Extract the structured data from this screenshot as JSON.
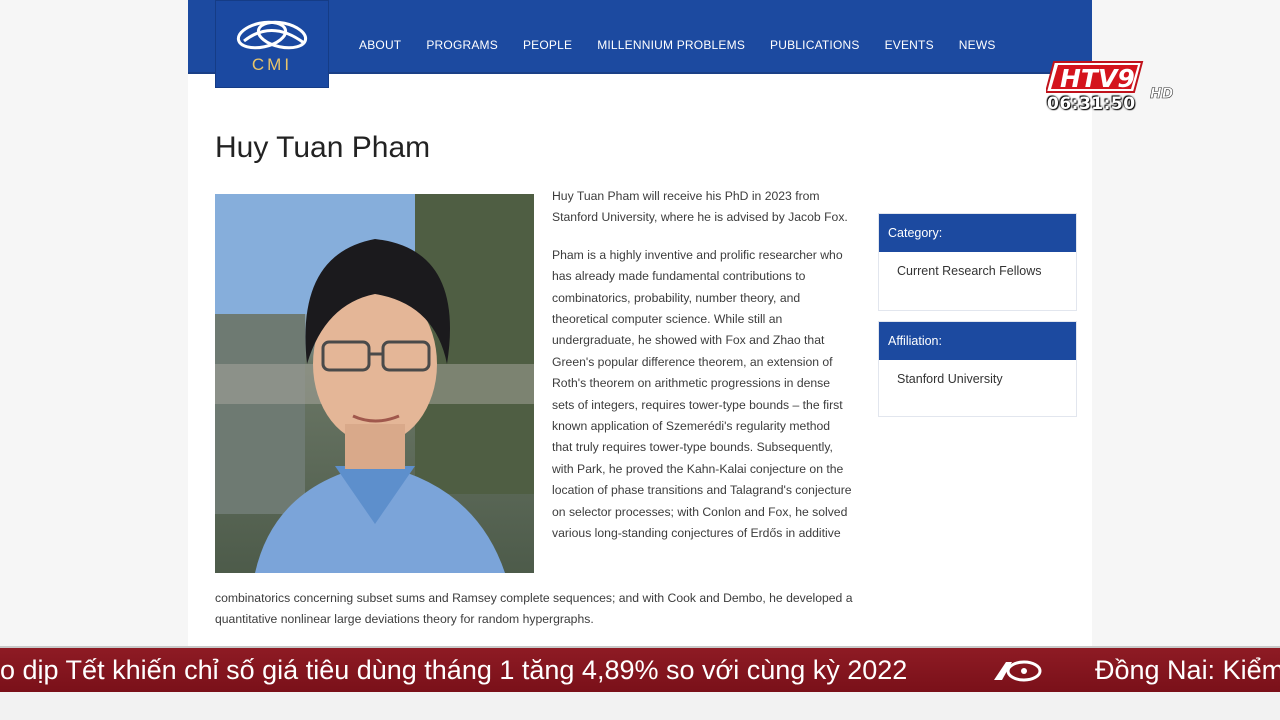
{
  "header": {
    "logo_text": "CMI",
    "nav": [
      "ABOUT",
      "PROGRAMS",
      "PEOPLE",
      "MILLENNIUM PROBLEMS",
      "PUBLICATIONS",
      "EVENTS",
      "NEWS"
    ]
  },
  "overlay": {
    "channel": "HTV9",
    "hd": "HD",
    "time": "06:31:50"
  },
  "person": {
    "name": "Huy Tuan Pham",
    "bio_p1": "Huy Tuan Pham will receive his PhD in 2023 from Stanford University, where he is advised by Jacob Fox.",
    "bio_p2": "Pham is a highly inventive and prolific researcher who has already made fundamental contributions to combinatorics, probability, number theory, and theoretical computer science.  While still an undergraduate, he showed with Fox and Zhao that Green's popular difference theorem, an extension of Roth's theorem on arithmetic progressions in dense sets of integers, requires tower-type bounds – the first known application of Szemerédi's regularity method that truly requires tower-type bounds.  Subsequently, with Park, he proved the Kahn-Kalai conjecture on the location of phase transitions and Talagrand's conjecture on selector processes; with Conlon and Fox, he solved various long-standing conjectures of Erdős in additive",
    "bio_tail": "combinatorics concerning subset sums and Ramsey complete sequences; and with Cook and Dembo, he developed a quantitative nonlinear large deviations theory for random hypergraphs."
  },
  "sidebar": {
    "category_label": "Category:",
    "category_value": "Current Research Fellows",
    "affiliation_label": "Affiliation:",
    "affiliation_value": "Stanford University"
  },
  "ticker": {
    "headline_1": "o dịp Tết khiến chỉ số giá tiêu dùng tháng 1 tăng 4,89% so với cùng kỳ 2022",
    "headline_2": "Đồng Nai: Kiểm"
  },
  "colors": {
    "nav_blue": "#1c4aa0",
    "ticker_red": "#8e1b24",
    "logo_gold": "#e8c46a"
  }
}
